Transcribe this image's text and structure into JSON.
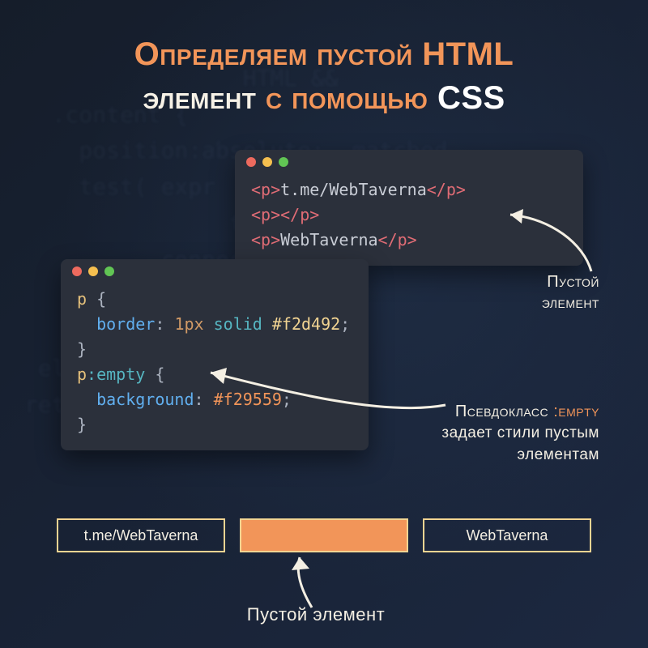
{
  "title": {
    "line1_accent": "Определяем пустой ",
    "line1_html": "HTML",
    "line2_plain": "элемент ",
    "line2_accent": "с помощью ",
    "line2_css": "CSS"
  },
  "html_window": {
    "lines": [
      {
        "open": "<p>",
        "text": "t.me/WebTaverna",
        "close": "</p>"
      },
      {
        "open": "<p>",
        "text": "",
        "close": "</p>"
      },
      {
        "open": "<p>",
        "text": "WebTaverna",
        "close": "</p>"
      }
    ]
  },
  "css_window": {
    "rule1": {
      "selector": "p",
      "prop": "border",
      "value_num": "1px",
      "value_kw": "solid",
      "value_hex": "#f2d492"
    },
    "rule2": {
      "selector": "p",
      "pseudo": ":empty",
      "prop": "background",
      "value_hex": "#f29559"
    }
  },
  "annotations": {
    "empty_element_top": "Пустой\nэлемент",
    "pseudo_label": "Псевдокласс ",
    "pseudo_keyword": ":empty",
    "pseudo_desc": "задает стили пустым элементам",
    "empty_element_bottom": "Пустой элемент"
  },
  "result": {
    "box1": "t.me/WebTaverna",
    "box2": "",
    "box3": "WebTaverna"
  },
  "colors": {
    "accent": "#f29559",
    "border_hex": "#f2d492"
  }
}
